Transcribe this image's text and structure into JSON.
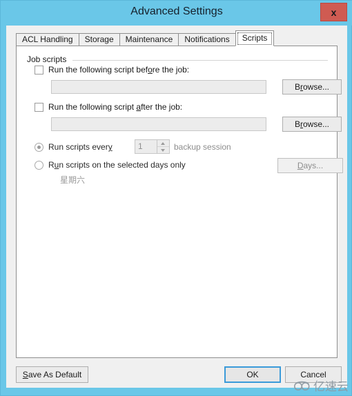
{
  "window": {
    "title": "Advanced Settings",
    "close_label": "x"
  },
  "tabs": [
    {
      "label": "ACL Handling",
      "active": false
    },
    {
      "label": "Storage",
      "active": false
    },
    {
      "label": "Maintenance",
      "active": false
    },
    {
      "label": "Notifications",
      "active": false
    },
    {
      "label": "Scripts",
      "active": true
    }
  ],
  "scripts_tab": {
    "group_legend": "Job scripts",
    "before": {
      "checkbox_label_pre": "Run the following script bef",
      "checkbox_label_acc": "o",
      "checkbox_label_post": "re the job:",
      "checked": false,
      "path_value": "",
      "browse_pre": "B",
      "browse_acc": "r",
      "browse_post": "owse..."
    },
    "after": {
      "checkbox_label_pre": "Run the following script ",
      "checkbox_label_acc": "a",
      "checkbox_label_post": "fter the job:",
      "checked": false,
      "path_value": "",
      "browse_pre": "B",
      "browse_acc": "r",
      "browse_post": "owse..."
    },
    "frequency": {
      "every_label_pre": "Run scripts ever",
      "every_label_acc": "y",
      "every_label_post": "",
      "every_selected": true,
      "interval_value": "1",
      "interval_unit": "backup session",
      "days_label_pre": "R",
      "days_label_acc": "u",
      "days_label_post": "n scripts on the selected days only",
      "days_selected": false,
      "selected_days_text": "星期六",
      "days_button_pre": "",
      "days_button_acc": "D",
      "days_button_post": "ays..."
    }
  },
  "footer": {
    "save_as_default_pre": "",
    "save_as_default_acc": "S",
    "save_as_default_post": "ave As Default",
    "ok_label": "OK",
    "cancel_label": "Cancel"
  },
  "watermark": {
    "text": "亿速云"
  },
  "colors": {
    "titlebar": "#6ac7e8",
    "close_button": "#cf5b52",
    "default_button_border": "#3a9ad9",
    "panel": "#ffffff",
    "client": "#f0f0f0"
  }
}
